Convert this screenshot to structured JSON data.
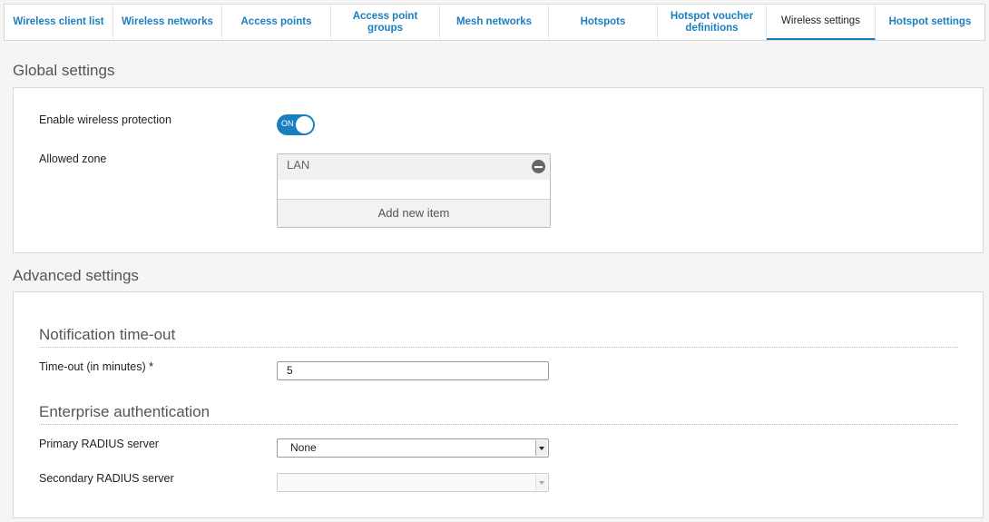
{
  "tabs": [
    {
      "label": "Wireless client list",
      "active": false
    },
    {
      "label": "Wireless networks",
      "active": false
    },
    {
      "label": "Access points",
      "active": false
    },
    {
      "label": "Access point groups",
      "active": false
    },
    {
      "label": "Mesh networks",
      "active": false
    },
    {
      "label": "Hotspots",
      "active": false
    },
    {
      "label": "Hotspot voucher definitions",
      "active": false
    },
    {
      "label": "Wireless settings",
      "active": true
    },
    {
      "label": "Hotspot settings",
      "active": false
    }
  ],
  "global": {
    "title": "Global settings",
    "enable_label": "Enable wireless protection",
    "toggle_text": "ON",
    "zone_label": "Allowed zone",
    "zones": [
      "LAN"
    ],
    "add_item": "Add new item"
  },
  "advanced": {
    "title": "Advanced settings",
    "notification_heading": "Notification time-out",
    "timeout_label": "Time-out (in minutes) *",
    "timeout_value": "5",
    "enterprise_heading": "Enterprise authentication",
    "primary_label": "Primary RADIUS server",
    "primary_value": "None",
    "secondary_label": "Secondary RADIUS server",
    "secondary_value": ""
  },
  "colors": {
    "accent": "#1a7fc1"
  }
}
